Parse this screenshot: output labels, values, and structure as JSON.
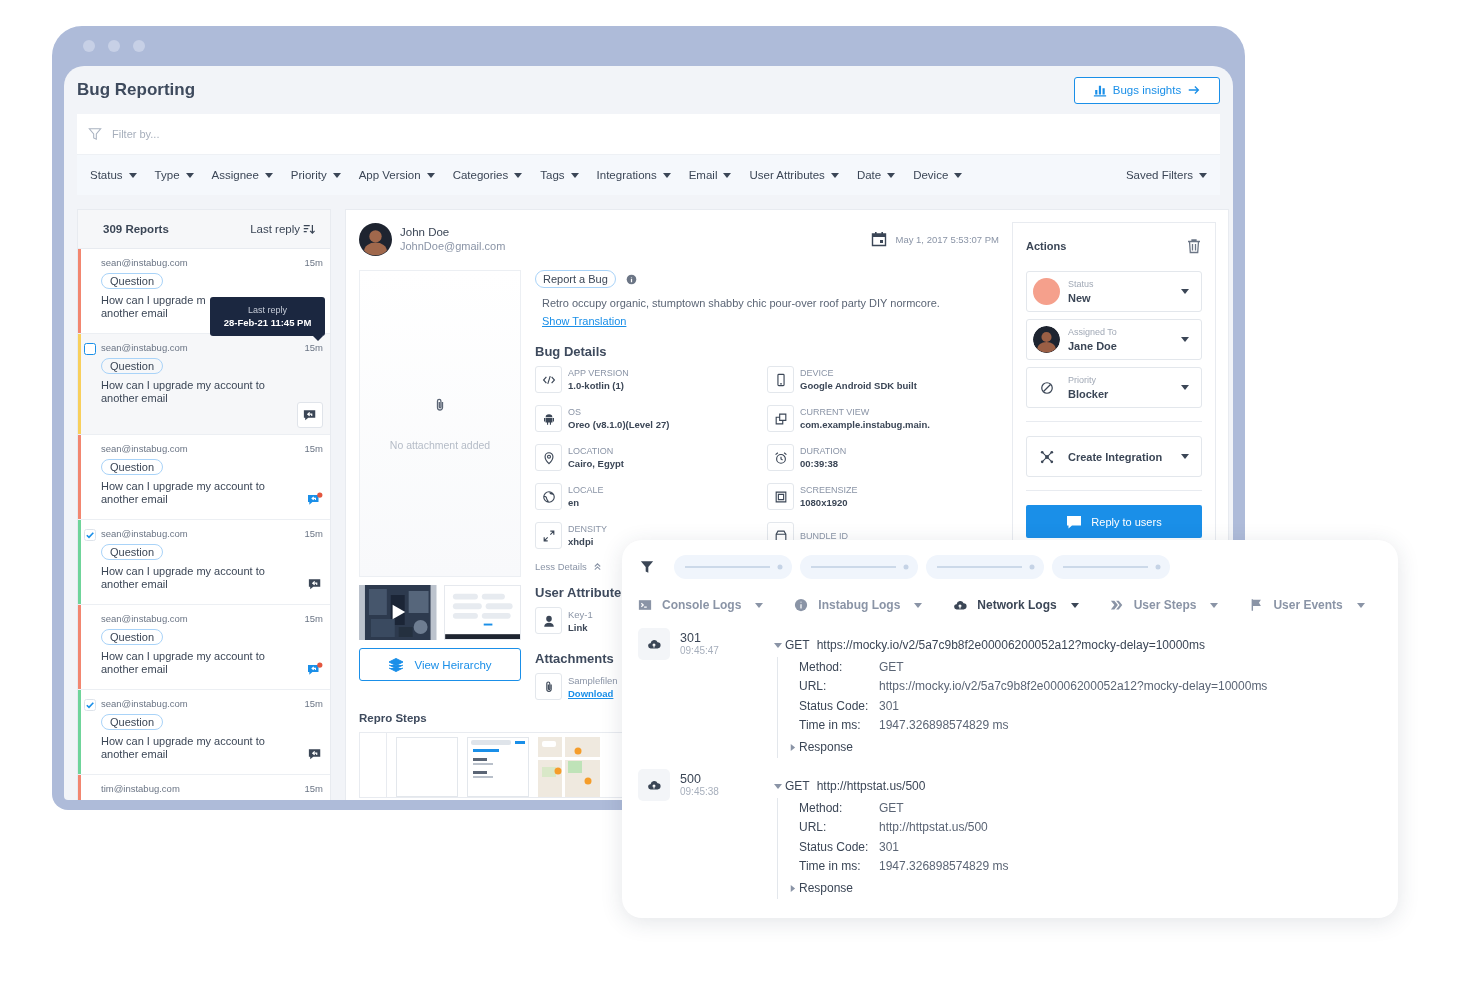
{
  "header": {
    "title": "Bug Reporting",
    "insights_button": "Bugs insights"
  },
  "filter": {
    "placeholder": "Filter by..."
  },
  "filter_menus": [
    {
      "label": "Status"
    },
    {
      "label": "Type"
    },
    {
      "label": "Assignee"
    },
    {
      "label": "Priority"
    },
    {
      "label": "App Version"
    },
    {
      "label": "Categories"
    },
    {
      "label": "Tags"
    },
    {
      "label": "Integrations"
    },
    {
      "label": "Email"
    },
    {
      "label": "User Attributes"
    },
    {
      "label": "Date"
    },
    {
      "label": "Device"
    }
  ],
  "saved_filters": "Saved Filters",
  "reports": {
    "count": "309 Reports",
    "sort": "Last reply",
    "items": [
      {
        "email": "sean@instabug.com",
        "time": "15m",
        "tag": "Question",
        "lines": [
          "How can I upgrade m",
          "another email"
        ],
        "color": "#f28670",
        "hovered": false
      },
      {
        "email": "sean@instabug.com",
        "time": "15m",
        "tag": "Question",
        "lines": [
          "How can I upgrade my account to",
          "another email"
        ],
        "color": "#f8cf5c",
        "checked": false,
        "hovered": true,
        "unread": false
      },
      {
        "email": "sean@instabug.com",
        "time": "15m",
        "tag": "Question",
        "lines": [
          "How can I upgrade my account to",
          "another email"
        ],
        "color": "#f28670",
        "hovered": false,
        "unread": true
      },
      {
        "email": "sean@instabug.com",
        "time": "15m",
        "tag": "Question",
        "lines": [
          "How can I upgrade my account to",
          "another email"
        ],
        "color": "#6fd49a",
        "checked": true,
        "hovered": false,
        "unread": false
      },
      {
        "email": "sean@instabug.com",
        "time": "15m",
        "tag": "Question",
        "lines": [
          "How can I upgrade my account to",
          "another email"
        ],
        "color": "#f28670",
        "hovered": false,
        "unread": true
      },
      {
        "email": "sean@instabug.com",
        "time": "15m",
        "tag": "Question",
        "lines": [
          "How can I upgrade my account to",
          "another email"
        ],
        "color": "#6fd49a",
        "checked": true,
        "hovered": false,
        "unread": false
      },
      {
        "email": "tim@instabug.com",
        "time": "15m",
        "color": "#f28670",
        "hovered": false
      }
    ]
  },
  "tooltip": {
    "title": "Last reply",
    "value": "28-Feb-21 11:45 PM"
  },
  "report": {
    "user": {
      "name": "John Doe",
      "email": "JohnDoe@gmail.com"
    },
    "date": "May 1, 2017 5:53:07 PM",
    "attachment_placeholder": "No attachment added",
    "view_hierarchy": "View Heirarchy",
    "repro_title": "Repro Steps",
    "type_tag": "Report a Bug",
    "description": "Retro occupy organic, stumptown shabby chic pour-over roof party DIY normcore.",
    "translation_link": "Show Translation",
    "details_title": "Bug Details",
    "details": [
      {
        "kind": "code",
        "label": "APP VERSION",
        "value": "1.0-kotlin (1)"
      },
      {
        "kind": "phone",
        "label": "DEVICE",
        "value": "Google Android SDK built"
      },
      {
        "kind": "robot",
        "label": "OS",
        "value": "Oreo (v8.1.0)(Level 27)"
      },
      {
        "kind": "windows",
        "label": "CURRENT VIEW",
        "value": "com.example.instabug.main."
      },
      {
        "kind": "pin",
        "label": "LOCATION",
        "value": "Cairo, Egypt"
      },
      {
        "kind": "alarm",
        "label": "DURATION",
        "value": "00:39:38"
      },
      {
        "kind": "globe",
        "label": "LOCALE",
        "value": "en"
      },
      {
        "kind": "frame",
        "label": "SCREENSIZE",
        "value": "1080x1920"
      },
      {
        "kind": "expand",
        "label": "DENSITY",
        "value": "xhdpi"
      },
      {
        "kind": "box",
        "label": "BUNDLE ID"
      }
    ],
    "less_details": "Less Details",
    "attributes_title": "User Attribute",
    "attributes": [
      {
        "key": "Key-1",
        "value": "Link"
      }
    ],
    "attachments_title": "Attachments",
    "attachments": [
      {
        "name": "Samplefilen",
        "link": "Download"
      }
    ]
  },
  "actions": {
    "title": "Actions",
    "fields": [
      {
        "kind": "status",
        "label": "Status",
        "value": "New",
        "color": "#f5a08c"
      },
      {
        "kind": "assignee",
        "label": "Assigned To",
        "value": "Jane Doe"
      },
      {
        "kind": "priority",
        "label": "Priority",
        "value": "Blocker"
      }
    ],
    "integration": "Create Integration",
    "reply": "Reply to users"
  },
  "logs": {
    "tabs": [
      {
        "kind": "console",
        "label": "Console Logs",
        "selected": false
      },
      {
        "kind": "info",
        "label": "Instabug Logs",
        "selected": false
      },
      {
        "kind": "cloud",
        "label": "Network Logs",
        "selected": true
      },
      {
        "kind": "steps",
        "label": "User Steps",
        "selected": false
      },
      {
        "kind": "flag",
        "label": "User Events",
        "selected": false
      }
    ],
    "entries": [
      {
        "status": "301",
        "time": "09:45:47",
        "method": "GET",
        "url": "https://mocky.io/v2/5a7c9b8f2e00006200052a12?mocky-delay=10000ms",
        "fields": [
          {
            "label": "Method:",
            "value": "GET"
          },
          {
            "label": "URL:",
            "value": "https://mocky.io/v2/5a7c9b8f2e00006200052a12?mocky-delay=10000ms"
          },
          {
            "label": "Status Code:",
            "value": "301"
          },
          {
            "label": "Time in ms:",
            "value": "1947.326898574829 ms"
          }
        ],
        "response": "Response"
      },
      {
        "status": "500",
        "time": "09:45:38",
        "method": "GET",
        "url": "http://httpstat.us/500",
        "fields": [
          {
            "label": "Method:",
            "value": "GET"
          },
          {
            "label": "URL:",
            "value": "http://httpstat.us/500"
          },
          {
            "label": "Status Code:",
            "value": "301"
          },
          {
            "label": "Time in ms:",
            "value": "1947.326898574829 ms"
          }
        ],
        "response": "Response"
      }
    ]
  }
}
